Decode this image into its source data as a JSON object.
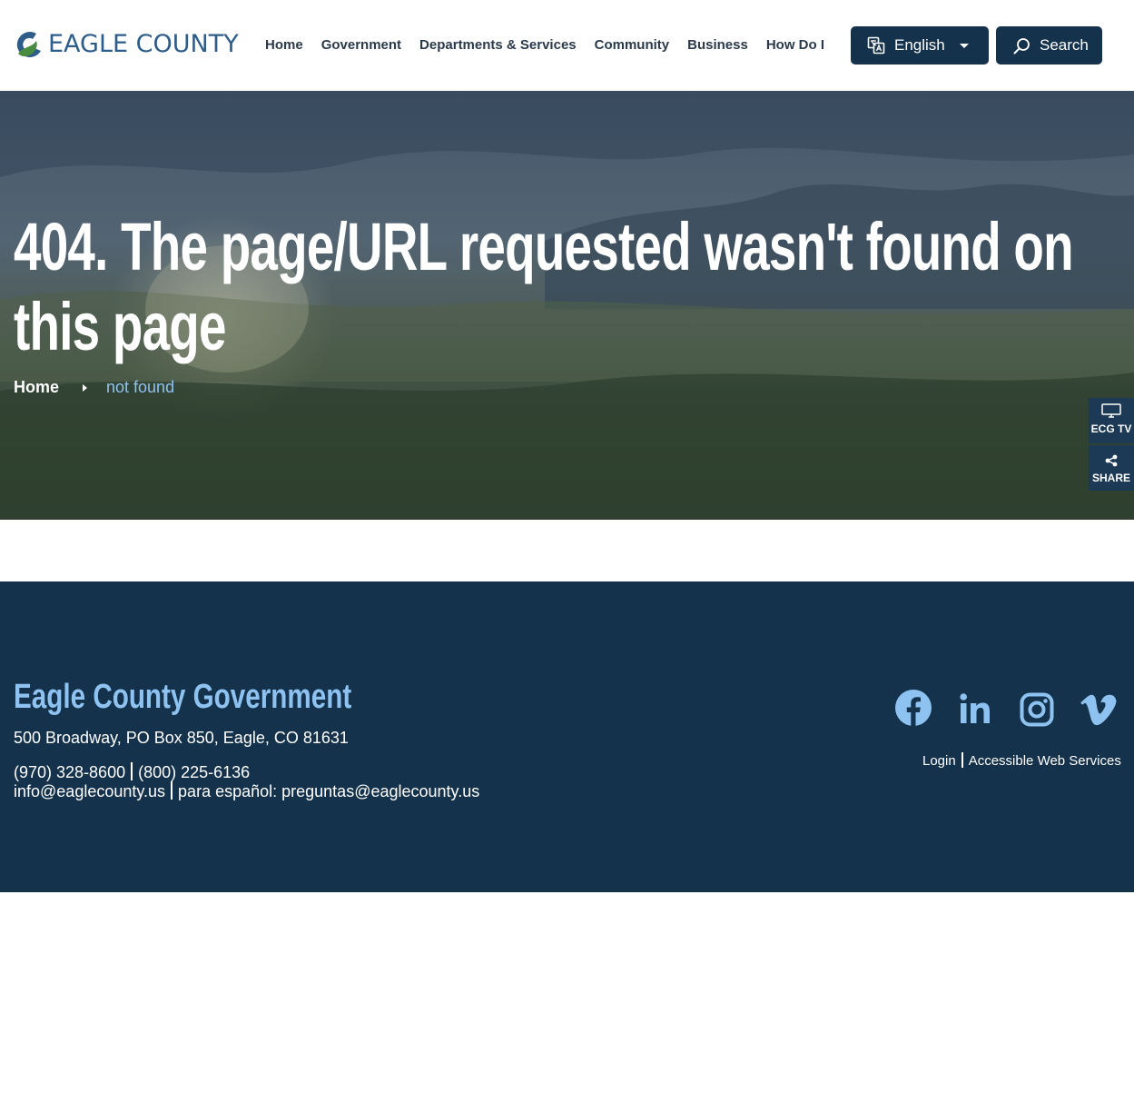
{
  "header": {
    "logo_text": "EAGLE COUNTY",
    "nav": [
      "Home",
      "Government",
      "Departments & Services",
      "Community",
      "Business",
      "How Do I"
    ],
    "language_label": "English",
    "search_label": "Search"
  },
  "hero": {
    "title": "404. The page/URL requested wasn't found on this page",
    "breadcrumb": {
      "home": "Home",
      "current": "not found"
    }
  },
  "side_widgets": {
    "tv_label": "ECG TV",
    "share_label": "SHARE"
  },
  "footer": {
    "title": "Eagle County Government",
    "address": "500 Broadway,  PO Box 850,  Eagle, CO  81631",
    "phone_1": "(970) 328-8600",
    "phone_2": "(800) 225-6136",
    "email": "info@eaglecounty.us",
    "spanish_email": "para español: preguntas@eaglecounty.us",
    "login_label": "Login",
    "accessible_label": "Accessible Web Services",
    "social": [
      "facebook-icon",
      "linkedin-icon",
      "instagram-icon",
      "vimeo-icon"
    ]
  },
  "colors": {
    "navy": "#14324b",
    "accent_blue": "#8ec2f0",
    "logo_blue": "#2e5d8a",
    "logo_green": "#4a8c3f"
  }
}
